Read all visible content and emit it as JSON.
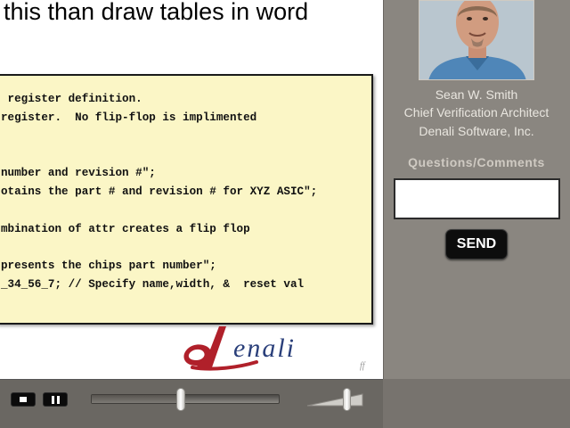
{
  "slide": {
    "title": "this than draw tables in word",
    "code_lines": [
      " register definition.",
      "register.  No flip-flop is implimented",
      "",
      "",
      "number and revision #\";",
      "otains the part # and revision # for XYZ ASIC\";",
      "",
      "mbination of attr creates a flip flop",
      "",
      "presents the chips part number\";",
      "_34_56_7; // Specify name,width, &  reset val"
    ],
    "logo_text": "denali",
    "slide_number": "ff",
    "colors": {
      "code_bg": "#fbf6c6",
      "logo_red": "#b0202a",
      "logo_blue": "#2a3f7a"
    }
  },
  "speaker": {
    "name": "Sean W. Smith",
    "title": "Chief Verification Architect",
    "company": "Denali Software, Inc."
  },
  "questions": {
    "heading": "Questions/Comments",
    "input_value": "",
    "send_label": "SEND"
  },
  "player": {
    "stop_icon": "stop-icon",
    "pause_icon": "pause-icon",
    "seek_position_fraction": 0.47,
    "volume_fraction": 0.7
  }
}
